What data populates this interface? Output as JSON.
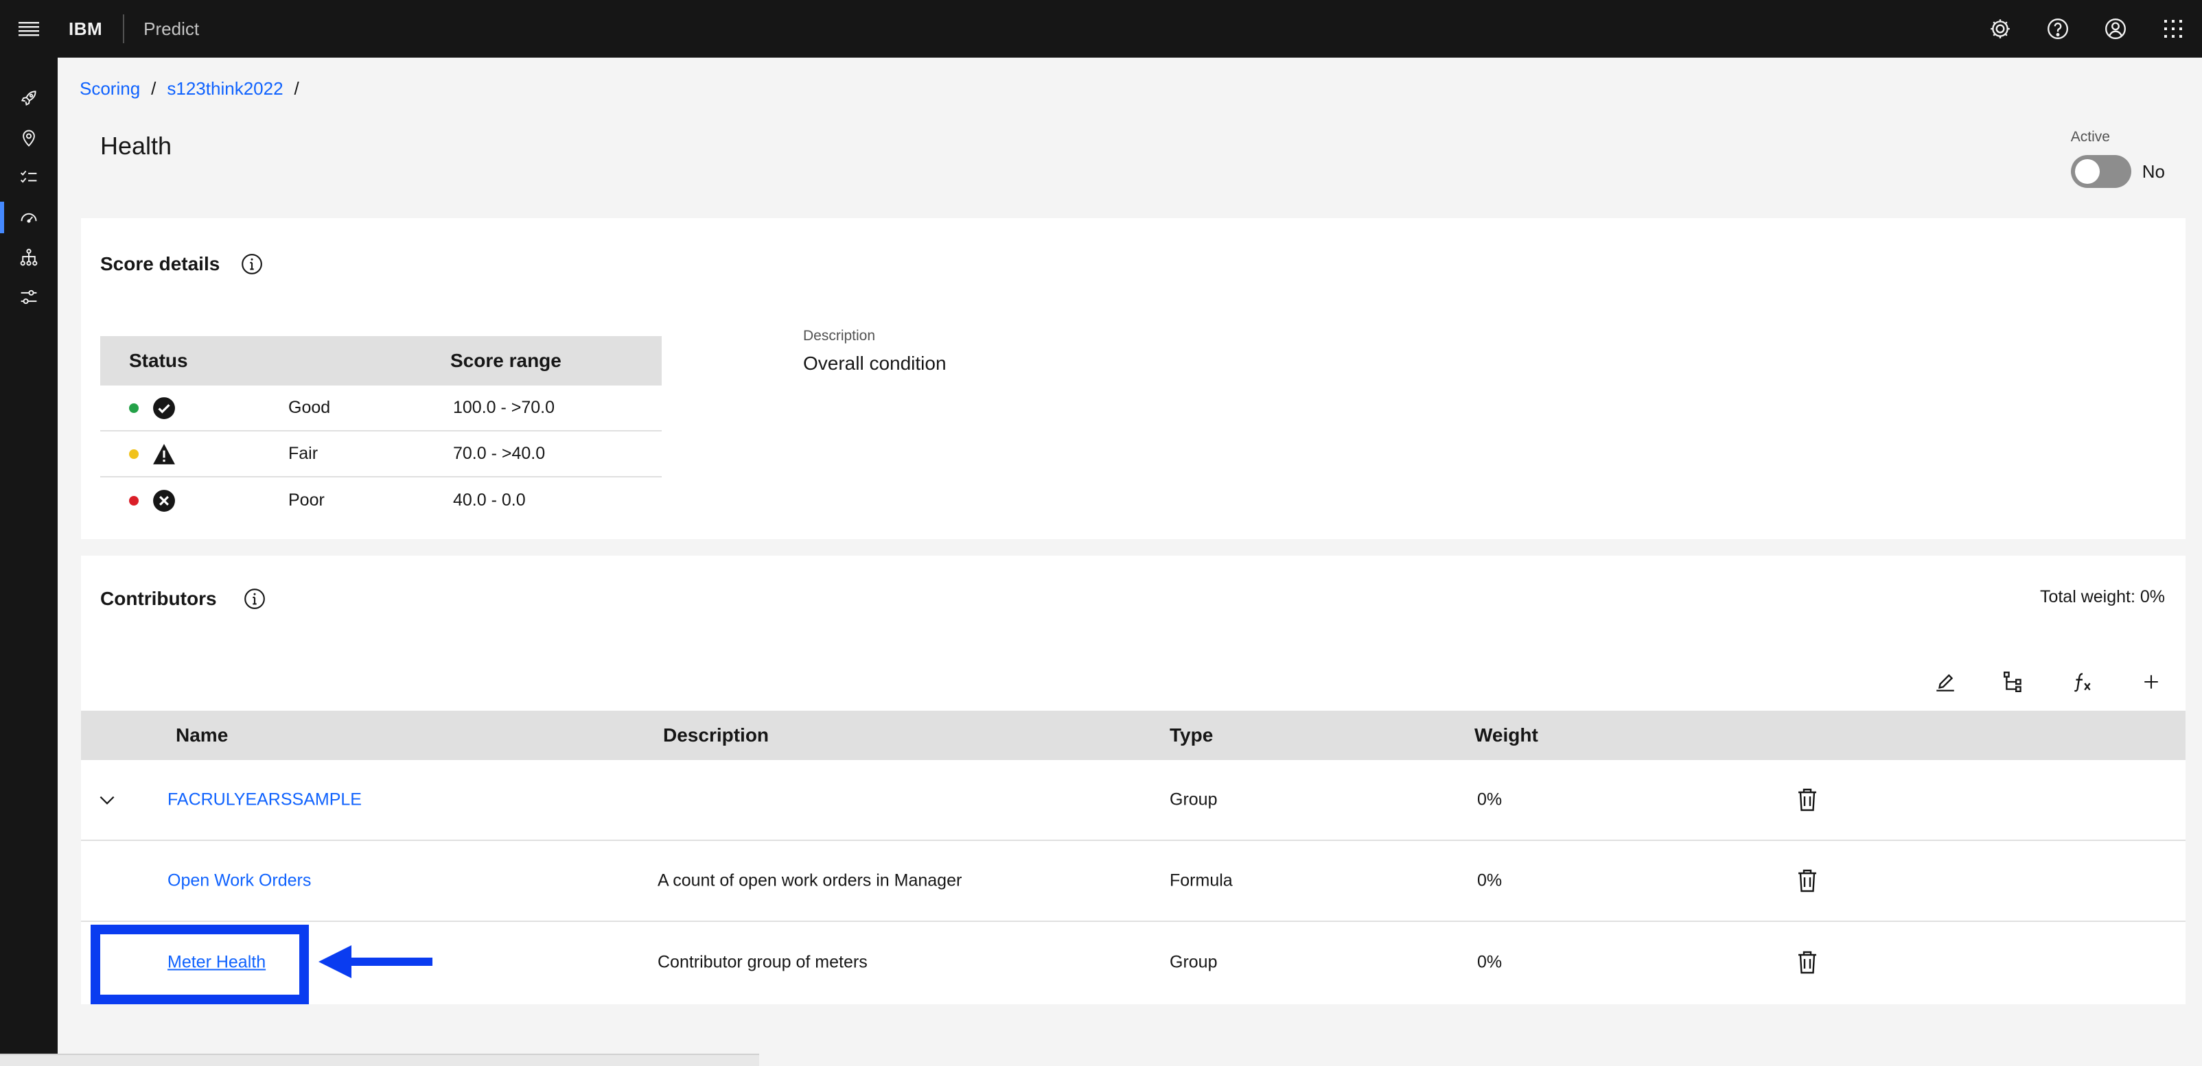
{
  "header": {
    "brand": "IBM",
    "product": "Predict",
    "actions": [
      {
        "icon": "gear-icon"
      },
      {
        "icon": "help-icon"
      },
      {
        "icon": "user-icon"
      },
      {
        "icon": "app-switcher-icon"
      }
    ]
  },
  "rail": {
    "items": [
      {
        "icon": "rocket-icon"
      },
      {
        "icon": "location-icon"
      },
      {
        "icon": "checklist-icon"
      },
      {
        "icon": "dashboard-gauge-icon",
        "active": true
      },
      {
        "icon": "hierarchy-icon"
      },
      {
        "icon": "settings-adjust-icon"
      }
    ]
  },
  "breadcrumb": {
    "items": [
      "Scoring",
      "s123think2022"
    ],
    "separator": "/"
  },
  "page": {
    "title": "Health",
    "active_label": "Active",
    "active_value": "No"
  },
  "score_details": {
    "title": "Score details",
    "columns": [
      "Status",
      "Score range"
    ],
    "rows": [
      {
        "status": "Good",
        "range": "100.0 - >70.0",
        "color": "#24a148",
        "icon": "checkmark-filled-icon"
      },
      {
        "status": "Fair",
        "range": "70.0 - >40.0",
        "color": "#f1c21b",
        "icon": "warning-filled-icon"
      },
      {
        "status": "Poor",
        "range": "40.0 - 0.0",
        "color": "#da1e28",
        "icon": "error-filled-icon"
      }
    ],
    "description_label": "Description",
    "description_value": "Overall condition"
  },
  "contributors": {
    "title": "Contributors",
    "total_weight": "Total weight: 0%",
    "toolbar": [
      {
        "icon": "edit-icon"
      },
      {
        "icon": "tree-view-icon"
      },
      {
        "icon": "function-icon"
      },
      {
        "icon": "add-icon"
      }
    ],
    "columns": [
      "Name",
      "Description",
      "Type",
      "Weight"
    ],
    "rows": [
      {
        "name": "FACRULYEARSSAMPLE",
        "description": "",
        "type": "Group",
        "weight": "0%",
        "expandable": true
      },
      {
        "name": "Open Work Orders",
        "description": "A count of open work orders in Manager",
        "type": "Formula",
        "weight": "0%"
      },
      {
        "name": "Meter Health",
        "description": "Contributor group of meters",
        "type": "Group",
        "weight": "0%",
        "highlighted": true
      }
    ]
  },
  "colors": {
    "header_bg": "#161616",
    "link": "#0f62fe",
    "annotation": "#0a3cf0"
  }
}
